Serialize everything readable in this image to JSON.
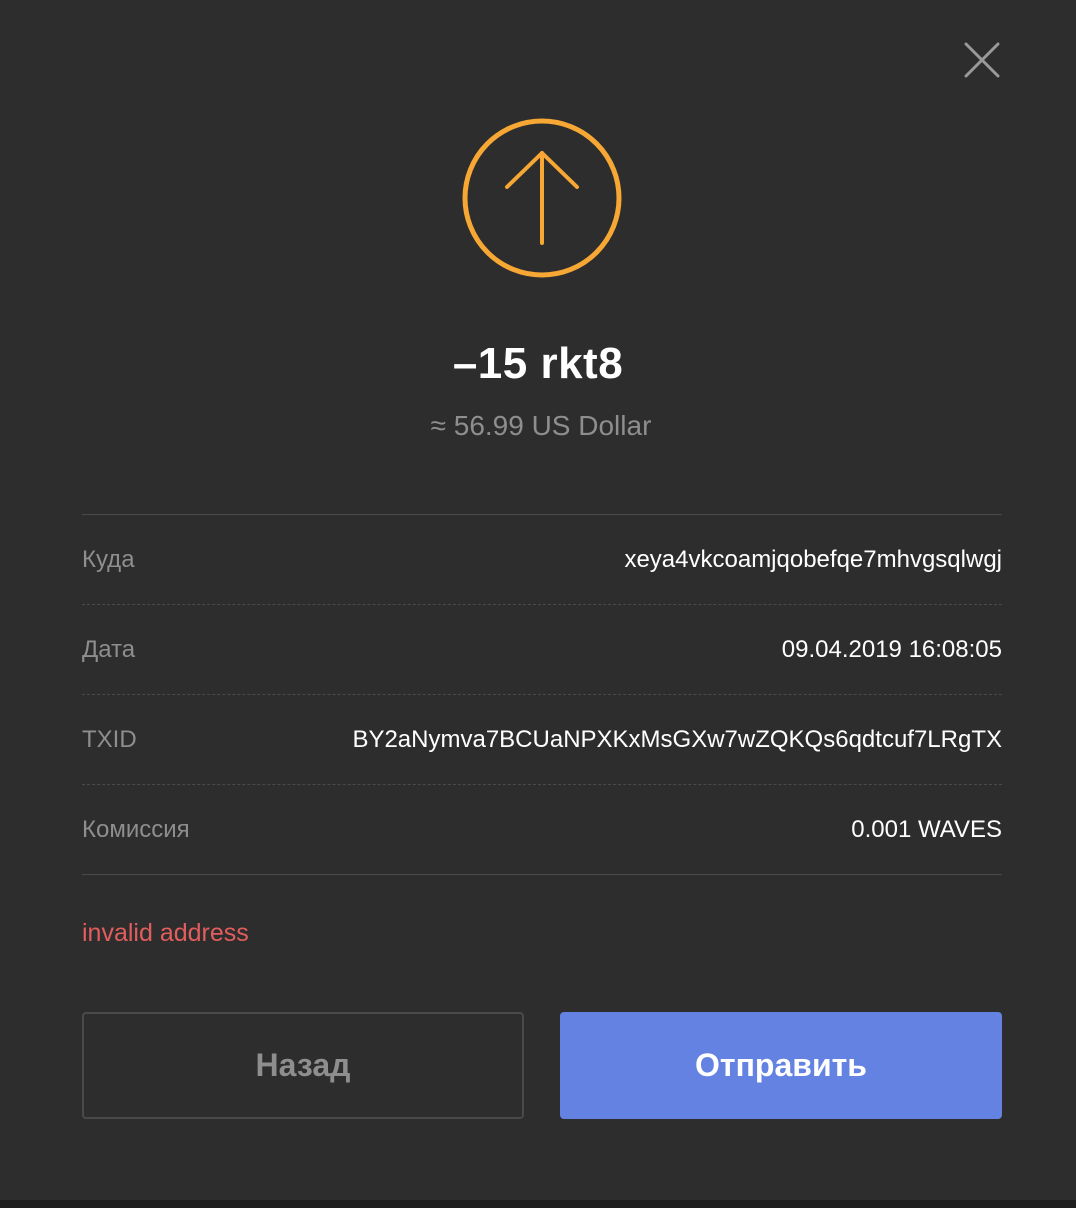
{
  "transaction": {
    "amount": "–15 rkt8",
    "fiat_equivalent": "≈ 56.99 US Dollar",
    "icon": "arrow-up-circle-icon",
    "accent_color": "#f7a733"
  },
  "details": [
    {
      "label": "Куда",
      "value": "xeya4vkcoamjqobefqe7mhvgsqlwgj"
    },
    {
      "label": "Дата",
      "value": "09.04.2019 16:08:05"
    },
    {
      "label": "TXID",
      "value": "BY2aNymva7BCUaNPXKxMsGXw7wZQKQs6qdtcuf7LRgTX"
    },
    {
      "label": "Комиссия",
      "value": "0.001 WAVES"
    }
  ],
  "error_message": "invalid address",
  "buttons": {
    "back_label": "Назад",
    "send_label": "Отправить",
    "send_color": "#6482e2"
  },
  "close_icon": "close-icon"
}
